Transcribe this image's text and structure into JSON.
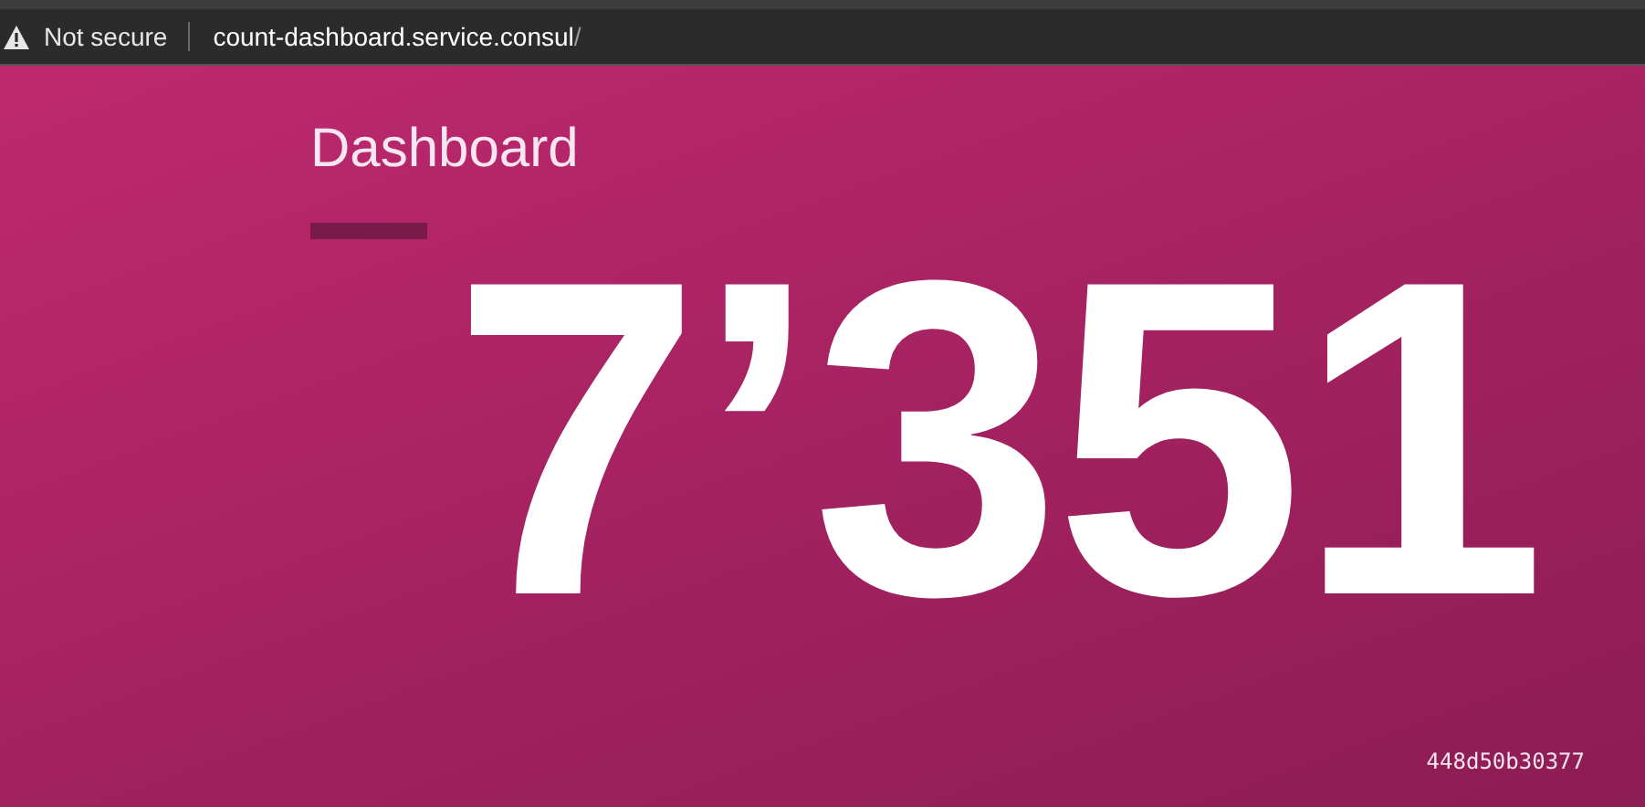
{
  "browser": {
    "security_label": "Not secure",
    "url_host": "count-dashboard.service.consul",
    "url_path": "/"
  },
  "page": {
    "title": "Dashboard",
    "count": "7’351",
    "hostname": "448d50b30377"
  }
}
